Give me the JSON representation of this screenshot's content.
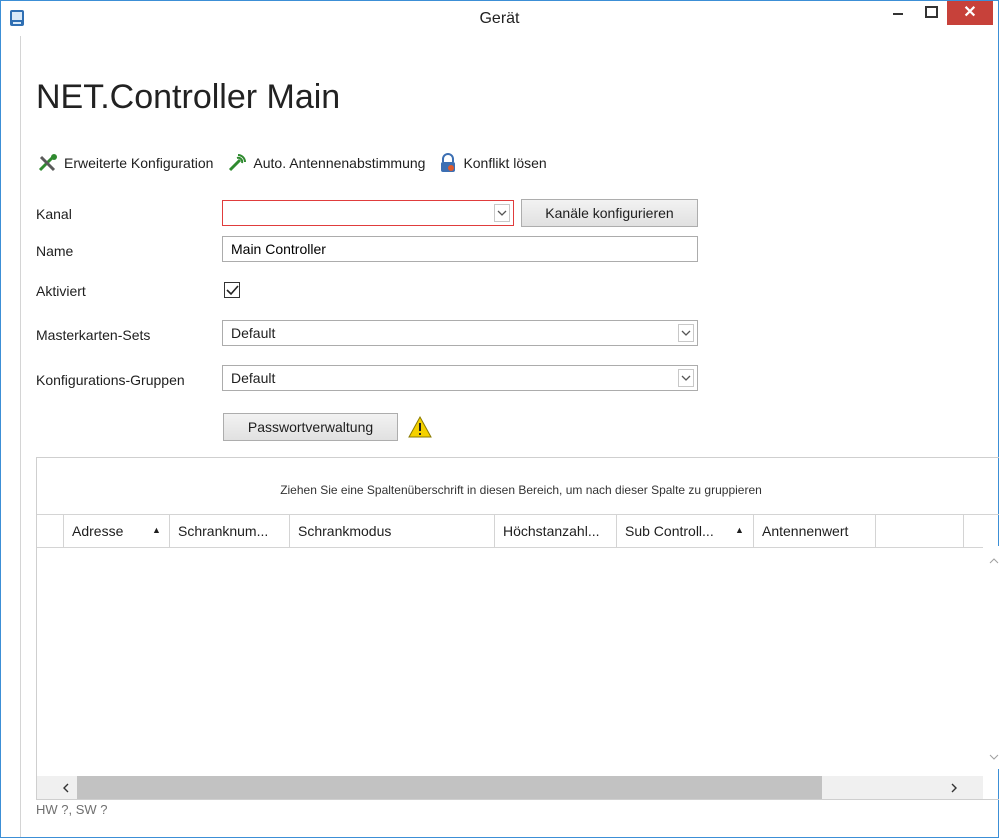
{
  "window": {
    "title": "Gerät",
    "close_glyph": "✕"
  },
  "page_title": "NET.Controller Main",
  "actions": [
    {
      "label": "Erweiterte Konfiguration",
      "icon": "tools-icon"
    },
    {
      "label": "Auto. Antennenabstimmung",
      "icon": "antenna-icon"
    },
    {
      "label": "Konflikt lösen",
      "icon": "lock-icon"
    }
  ],
  "form": {
    "kanal_label": "Kanal",
    "kanal_value": "",
    "kanal_button": "Kanäle konfigurieren",
    "name_label": "Name",
    "name_value": "Main Controller",
    "aktiviert_label": "Aktiviert",
    "aktiviert_checked": true,
    "masterkarten_label": "Masterkarten-Sets",
    "masterkarten_value": "Default",
    "gruppen_label": "Konfigurations-Gruppen",
    "gruppen_value": "Default",
    "passwort_button": "Passwortverwaltung"
  },
  "grid": {
    "group_hint": "Ziehen Sie eine Spaltenüberschrift in diesen Bereich, um nach dieser Spalte zu gruppieren",
    "columns": [
      "Adresse",
      "Schranknum...",
      "Schrankmodus",
      "Höchstanzahl...",
      "Sub Controll...",
      "Antennenwert"
    ]
  },
  "status": "HW ?, SW ?",
  "colors": {
    "accent": "#3c8fd6",
    "close": "#c7413a",
    "error": "#e03c3c",
    "warning": "#f5d100"
  }
}
